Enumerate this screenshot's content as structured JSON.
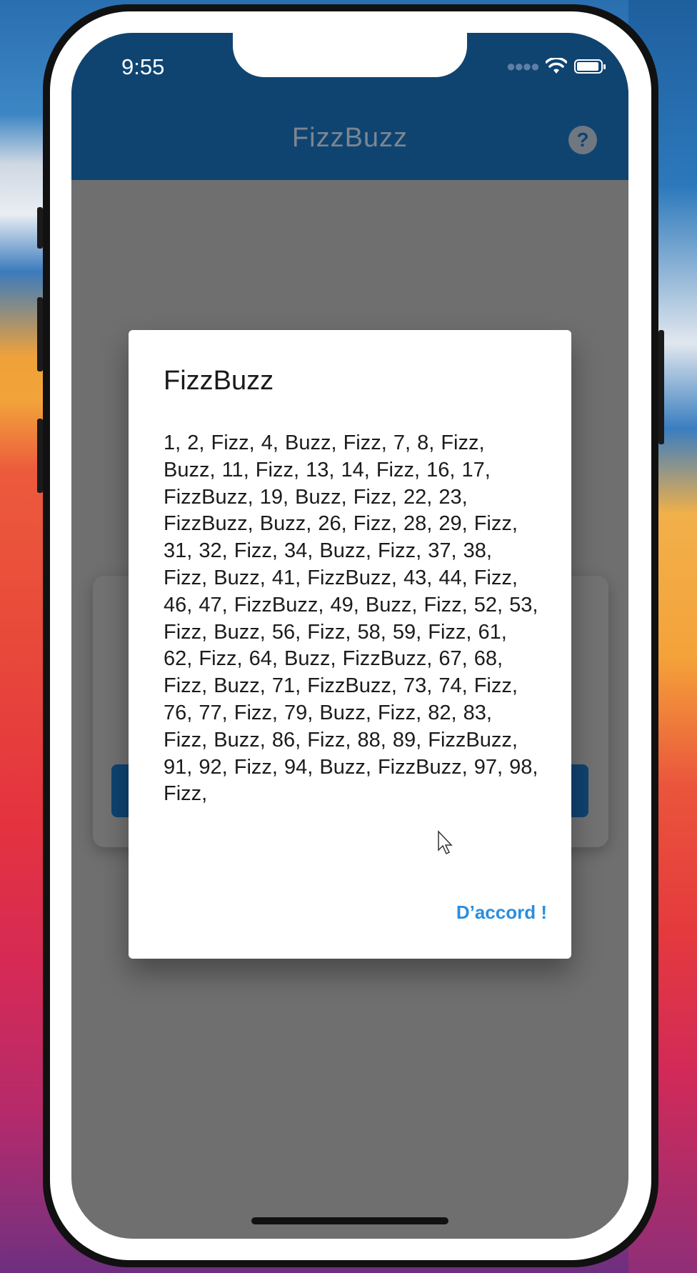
{
  "status_bar": {
    "time": "9:55",
    "icons": [
      "cellular-signal-icon",
      "wifi-icon",
      "battery-icon"
    ]
  },
  "app_bar": {
    "title": "FizzBuzz",
    "help_icon": "question-circle-icon",
    "help_glyph": "?"
  },
  "dialog": {
    "title": "FizzBuzz",
    "body": "1, 2, Fizz, 4, Buzz, Fizz, 7, 8, Fizz, Buzz, 11, Fizz, 13, 14, Fizz, 16, 17, FizzBuzz, 19, Buzz, Fizz, 22, 23, FizzBuzz, Buzz, 26, Fizz, 28, 29, Fizz, 31, 32, Fizz, 34, Buzz, Fizz, 37, 38, Fizz, Buzz, 41, FizzBuzz, 43, 44, Fizz, 46, 47, FizzBuzz, 49, Buzz, Fizz, 52, 53, Fizz, Buzz, 56, Fizz, 58, 59, Fizz, 61, 62, Fizz, 64, Buzz, FizzBuzz, 67, 68, Fizz, Buzz, 71, FizzBuzz, 73, 74, Fizz, 76, 77, Fizz, 79, Buzz, Fizz, 82, 83, Fizz, Buzz, 86, Fizz, 88, 89, FizzBuzz, 91, 92, Fizz, 94, Buzz, FizzBuzz, 97, 98, Fizz,",
    "action_label": "D’accord !"
  },
  "colors": {
    "app_bar": "#0f4471",
    "accent": "#2b8ede",
    "scrim": "#6f6f6f"
  }
}
